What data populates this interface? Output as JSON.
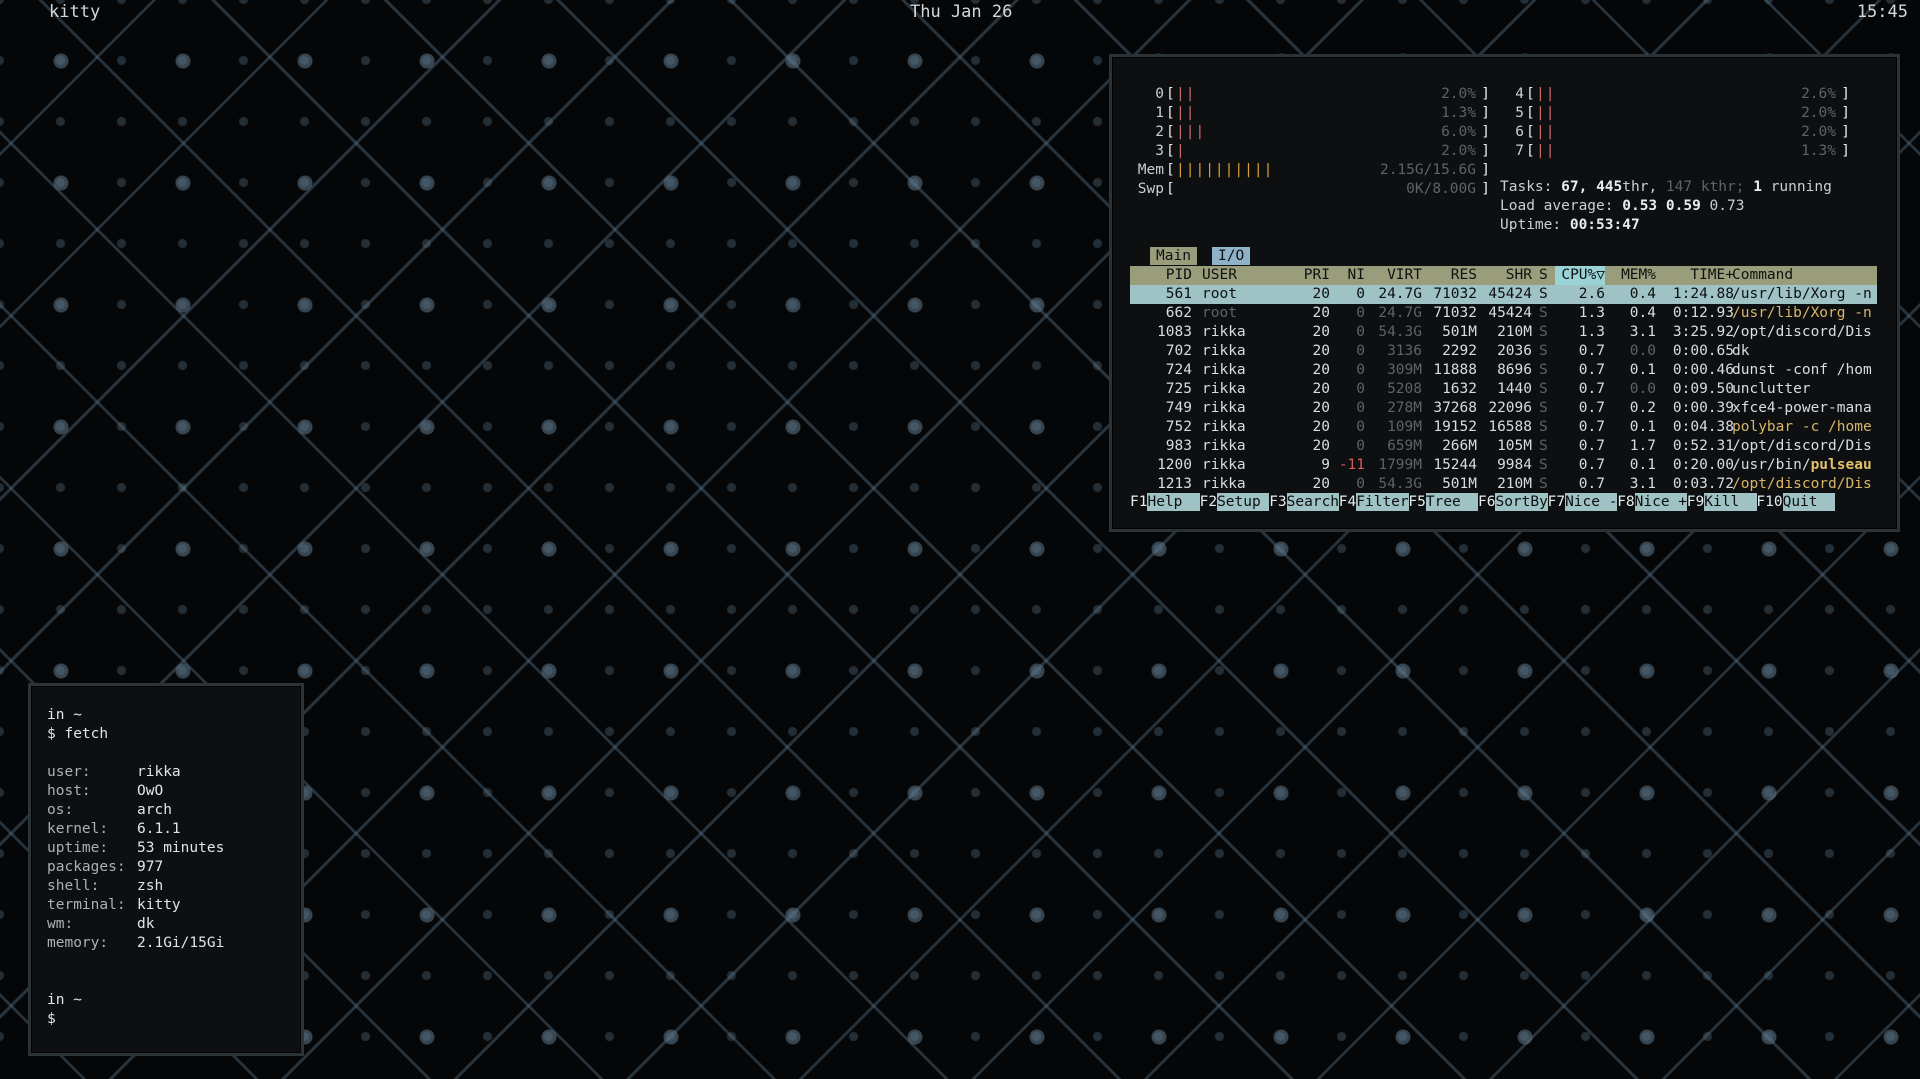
{
  "topbar": {
    "title": "kitty",
    "date": "Thu Jan 26",
    "time": "15:45"
  },
  "htop": {
    "cpus": [
      {
        "id": "0",
        "value": "2.0%",
        "bars": "||"
      },
      {
        "id": "1",
        "value": "1.3%",
        "bars": "||"
      },
      {
        "id": "2",
        "value": "6.0%",
        "bars": "|||"
      },
      {
        "id": "3",
        "value": "2.0%",
        "bars": "|"
      },
      {
        "id": "4",
        "value": "2.6%",
        "bars": "||"
      },
      {
        "id": "5",
        "value": "2.0%",
        "bars": "||"
      },
      {
        "id": "6",
        "value": "2.0%",
        "bars": "||"
      },
      {
        "id": "7",
        "value": "1.3%",
        "bars": "||"
      }
    ],
    "mem": {
      "label": "Mem",
      "bars": "||||||||||",
      "value": "2.15G/15.6G"
    },
    "swp": {
      "label": "Swp",
      "bars": "",
      "value": "0K/8.00G"
    },
    "tasks": {
      "label": "Tasks:",
      "count": "67,",
      "thr": "445",
      "thr_label": "thr,",
      "kthr": "147 kthr;",
      "running_count": "1",
      "running_label": "running"
    },
    "load": {
      "label": "Load average:",
      "one": "0.53",
      "five": "0.59",
      "fifteen": "0.73"
    },
    "uptime": {
      "label": "Uptime:",
      "value": "00:53:47"
    },
    "tabs": [
      "Main",
      "I/O"
    ],
    "columns": {
      "pid": "PID",
      "user": "USER",
      "pri": "PRI",
      "ni": "NI",
      "virt": "VIRT",
      "res": "RES",
      "shr": "SHR",
      "s": "S",
      "cpu": "CPU%▽",
      "mem": "MEM%",
      "time": "TIME+",
      "cmd": "Command"
    },
    "processes": [
      {
        "pid": "561",
        "user": "root",
        "pri": "20",
        "ni": "0",
        "virt": "24.7G",
        "res": "71032",
        "shr": "45424",
        "s": "S",
        "cpu": "2.6",
        "mem": "0.4",
        "time": "1:24.88",
        "cmd": "/usr/lib/Xorg -n"
      },
      {
        "pid": "662",
        "user": "root",
        "pri": "20",
        "ni": "0",
        "virt": "24.7G",
        "res": "71032",
        "shr": "45424",
        "s": "S",
        "cpu": "1.3",
        "mem": "0.4",
        "time": "0:12.93",
        "cmd": "/usr/lib/Xorg -n"
      },
      {
        "pid": "1083",
        "user": "rikka",
        "pri": "20",
        "ni": "0",
        "virt": "54.3G",
        "res": "501M",
        "shr": "210M",
        "s": "S",
        "cpu": "1.3",
        "mem": "3.1",
        "time": "3:25.92",
        "cmd": "/opt/discord/Dis"
      },
      {
        "pid": "702",
        "user": "rikka",
        "pri": "20",
        "ni": "0",
        "virt": "3136",
        "res": "2292",
        "shr": "2036",
        "s": "S",
        "cpu": "0.7",
        "mem": "0.0",
        "time": "0:00.65",
        "cmd": "dk"
      },
      {
        "pid": "724",
        "user": "rikka",
        "pri": "20",
        "ni": "0",
        "virt": "309M",
        "res": "11888",
        "shr": "8696",
        "s": "S",
        "cpu": "0.7",
        "mem": "0.1",
        "time": "0:00.46",
        "cmd": "dunst -conf /hom"
      },
      {
        "pid": "725",
        "user": "rikka",
        "pri": "20",
        "ni": "0",
        "virt": "5208",
        "res": "1632",
        "shr": "1440",
        "s": "S",
        "cpu": "0.7",
        "mem": "0.0",
        "time": "0:09.50",
        "cmd": "unclutter"
      },
      {
        "pid": "749",
        "user": "rikka",
        "pri": "20",
        "ni": "0",
        "virt": "278M",
        "res": "37268",
        "shr": "22096",
        "s": "S",
        "cpu": "0.7",
        "mem": "0.2",
        "time": "0:00.39",
        "cmd": "xfce4-power-mana"
      },
      {
        "pid": "752",
        "user": "rikka",
        "pri": "20",
        "ni": "0",
        "virt": "109M",
        "res": "19152",
        "shr": "16588",
        "s": "S",
        "cpu": "0.7",
        "mem": "0.1",
        "time": "0:04.38",
        "cmd": "polybar -c /home"
      },
      {
        "pid": "983",
        "user": "rikka",
        "pri": "20",
        "ni": "0",
        "virt": "659M",
        "res": "266M",
        "shr": "105M",
        "s": "S",
        "cpu": "0.7",
        "mem": "1.7",
        "time": "0:52.31",
        "cmd": "/opt/discord/Dis"
      },
      {
        "pid": "1200",
        "user": "rikka",
        "pri": "9",
        "ni": "-11",
        "virt": "1799M",
        "res": "15244",
        "shr": "9984",
        "s": "S",
        "cpu": "0.7",
        "mem": "0.1",
        "time": "0:20.00",
        "cmd_pre": "/usr/bin/",
        "cmd_hl": "pulseau"
      },
      {
        "pid": "1213",
        "user": "rikka",
        "pri": "20",
        "ni": "0",
        "virt": "54.3G",
        "res": "501M",
        "shr": "210M",
        "s": "S",
        "cpu": "0.7",
        "mem": "3.1",
        "time": "0:03.72",
        "cmd": "/opt/discord/Dis"
      }
    ],
    "fkeys": [
      {
        "k": "F1",
        "l": "Help  "
      },
      {
        "k": "F2",
        "l": "Setup "
      },
      {
        "k": "F3",
        "l": "Search"
      },
      {
        "k": "F4",
        "l": "Filter"
      },
      {
        "k": "F5",
        "l": "Tree  "
      },
      {
        "k": "F6",
        "l": "SortBy"
      },
      {
        "k": "F7",
        "l": "Nice -"
      },
      {
        "k": "F8",
        "l": "Nice +"
      },
      {
        "k": "F9",
        "l": "Kill  "
      },
      {
        "k": "F10",
        "l": "Quit  "
      }
    ]
  },
  "terminal": {
    "prompt_dir": "in ~",
    "command": "$ fetch",
    "fetch": [
      {
        "key": "user:",
        "val": "rikka"
      },
      {
        "key": "host:",
        "val": "OwO"
      },
      {
        "key": "os:",
        "val": "arch"
      },
      {
        "key": "kernel:",
        "val": "6.1.1"
      },
      {
        "key": "uptime:",
        "val": "53 minutes"
      },
      {
        "key": "packages:",
        "val": "977"
      },
      {
        "key": "shell:",
        "val": "zsh"
      },
      {
        "key": "terminal:",
        "val": "kitty"
      },
      {
        "key": "wm:",
        "val": "dk"
      },
      {
        "key": "memory:",
        "val": "2.1Gi/15Gi"
      }
    ],
    "prompt_dir2": "in ~",
    "prompt": "$"
  },
  "colors": {
    "accent": "#9fc3c4",
    "header": "#9a9d7b",
    "cpu_bar": "#c76969",
    "mem_bar": "#d89f3a",
    "highlight": "#e0c06a"
  }
}
